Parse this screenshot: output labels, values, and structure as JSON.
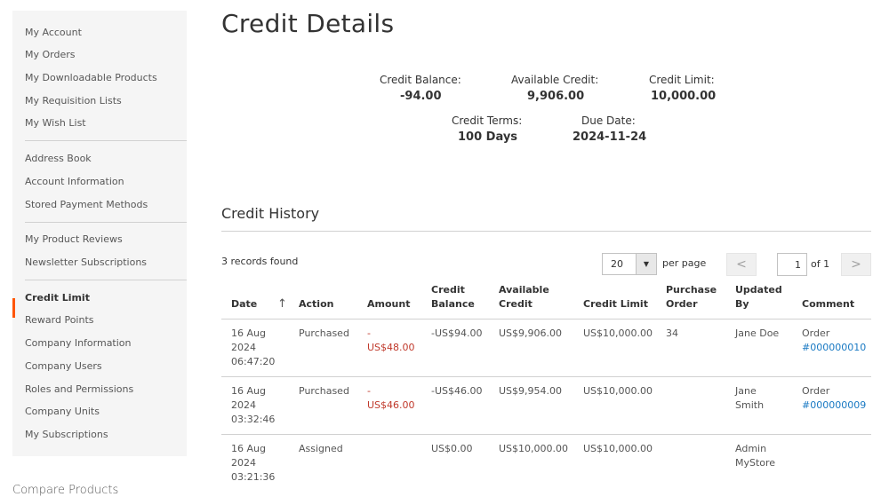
{
  "sidebar": {
    "groups": [
      [
        "My Account",
        "My Orders",
        "My Downloadable Products",
        "My Requisition Lists",
        "My Wish List"
      ],
      [
        "Address Book",
        "Account Information",
        "Stored Payment Methods"
      ],
      [
        "My Product Reviews",
        "Newsletter Subscriptions"
      ],
      [
        "Credit Limit",
        "Reward Points",
        "Company Information",
        "Company Users",
        "Roles and Permissions",
        "Company Units",
        "My Subscriptions"
      ]
    ],
    "active": "Credit Limit",
    "compare_title": "Compare Products"
  },
  "page_title": "Credit Details",
  "summary": {
    "credit_balance_label": "Credit Balance:",
    "credit_balance_value": "-94.00",
    "available_credit_label": "Available Credit:",
    "available_credit_value": "9,906.00",
    "credit_limit_label": "Credit Limit:",
    "credit_limit_value": "10,000.00",
    "credit_terms_label": "Credit Terms:",
    "credit_terms_value": "100 Days",
    "due_date_label": "Due Date:",
    "due_date_value": "2024-11-24"
  },
  "history": {
    "title": "Credit History",
    "records_found": "3 records found",
    "limiter_value": "20",
    "per_page": "per page",
    "prev": "<",
    "next": ">",
    "page": "1",
    "of_pages": "of 1",
    "sort_arrow": "↑",
    "columns": {
      "date": "Date",
      "action": "Action",
      "amount": "Amount",
      "credit_balance": [
        "Credit",
        "Balance"
      ],
      "available_credit": [
        "Available",
        "Credit"
      ],
      "credit_limit": "Credit Limit",
      "purchase_order": [
        "Purchase",
        "Order"
      ],
      "updated_by": [
        "Updated",
        "By"
      ],
      "comment": "Comment"
    },
    "rows": [
      {
        "date": [
          "16 Aug",
          "2024",
          "06:47:20"
        ],
        "action": "Purchased",
        "amount": [
          "-",
          "US$48.00"
        ],
        "credit_balance": "-US$94.00",
        "available_credit": "US$9,906.00",
        "credit_limit": "US$10,000.00",
        "purchase_order": "34",
        "updated_by": [
          "Jane Doe"
        ],
        "comment": [
          "Order",
          "#000000010"
        ]
      },
      {
        "date": [
          "16 Aug",
          "2024",
          "03:32:46"
        ],
        "action": "Purchased",
        "amount": [
          "-",
          "US$46.00"
        ],
        "credit_balance": "-US$46.00",
        "available_credit": "US$9,954.00",
        "credit_limit": "US$10,000.00",
        "purchase_order": "",
        "updated_by": [
          "Jane",
          "Smith"
        ],
        "comment": [
          "Order",
          "#000000009"
        ]
      },
      {
        "date": [
          "16 Aug",
          "2024",
          "03:21:36"
        ],
        "action": "Assigned",
        "amount": [
          "",
          ""
        ],
        "credit_balance": "US$0.00",
        "available_credit": "US$10,000.00",
        "credit_limit": "US$10,000.00",
        "purchase_order": "",
        "updated_by": [
          "Admin",
          "MyStore"
        ],
        "comment": [
          "",
          ""
        ]
      }
    ]
  },
  "colors": {
    "accent": "#ff5501",
    "link": "#1979c3",
    "negative": "#c0392b",
    "sidebar_bg": "#f5f5f5"
  }
}
